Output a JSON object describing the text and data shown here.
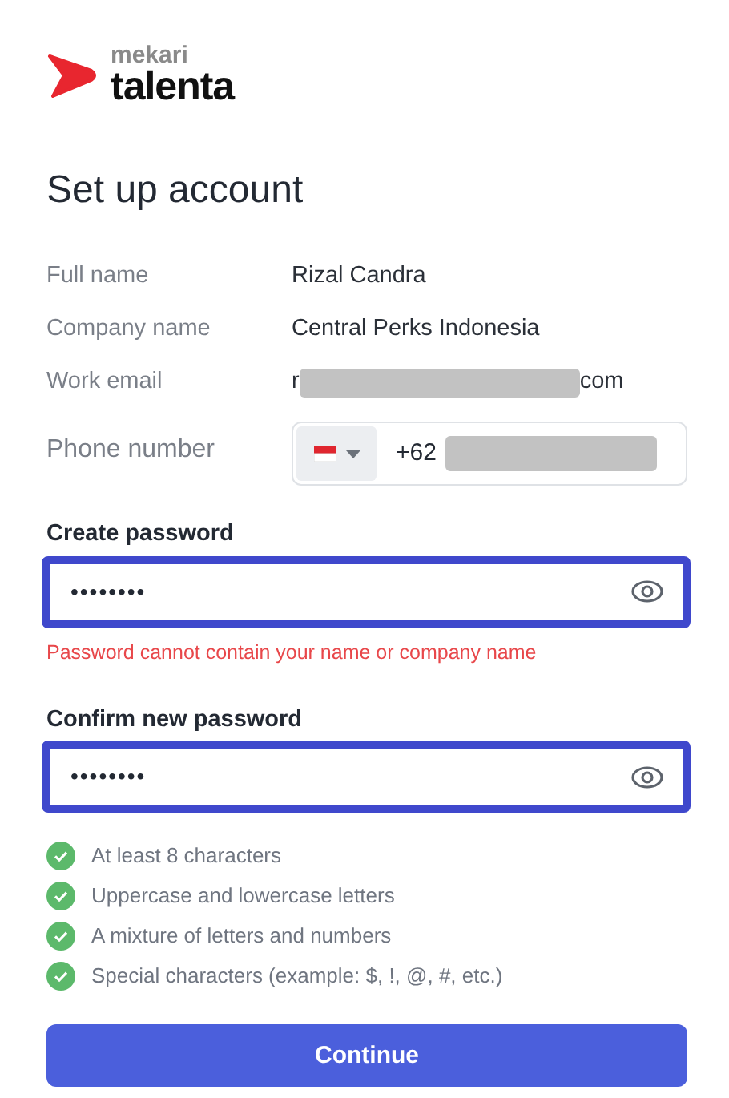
{
  "logo": {
    "brand_small": "mekari",
    "brand_large": "talenta"
  },
  "title": "Set up account",
  "details": [
    {
      "label": "Full name",
      "value": "Rizal Candra"
    },
    {
      "label": "Company name",
      "value": "Central Perks Indonesia"
    },
    {
      "label": "Work email",
      "value_start": "r",
      "redacted": true,
      "value_end": "com"
    }
  ],
  "phone": {
    "label": "Phone number",
    "prefix": "+62",
    "redacted": true
  },
  "passwords": [
    {
      "label": "Create password",
      "value": "••••••••",
      "focused": true,
      "error": "Password cannot contain your name or company name"
    },
    {
      "label": "Confirm new password",
      "value": "••••••••",
      "focused": true
    }
  ],
  "rules": [
    {
      "text": "At least 8 characters",
      "met": true
    },
    {
      "text": "Uppercase and lowercase letters",
      "met": true
    },
    {
      "text": "A mixture of letters and numbers",
      "met": true
    },
    {
      "text": "Special characters (example: $, !, @, #, etc.)",
      "met": true
    }
  ],
  "button": "Continue"
}
